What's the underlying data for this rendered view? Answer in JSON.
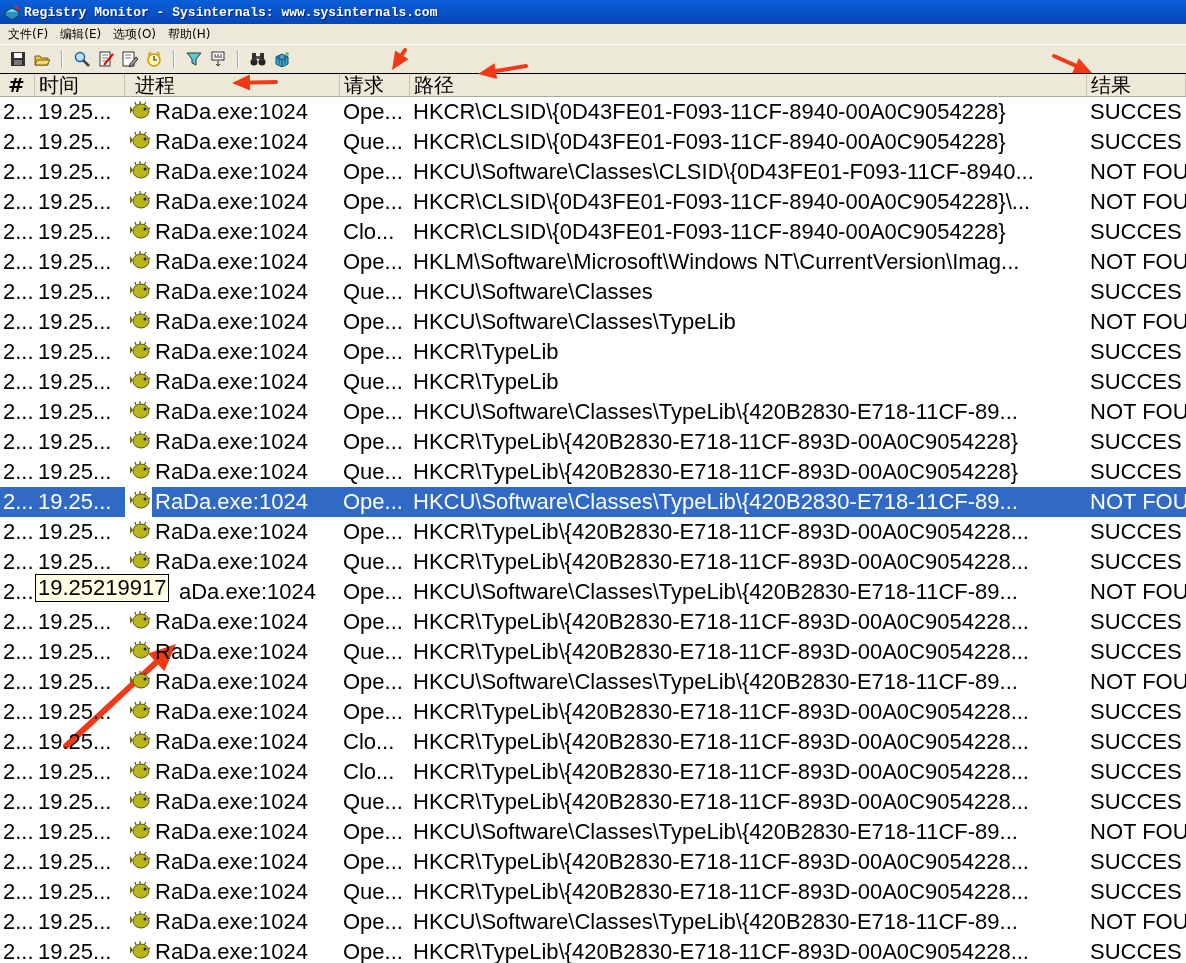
{
  "window": {
    "title": "Registry Monitor - Sysinternals: www.sysinternals.com"
  },
  "menu": [
    "文件(F)",
    "编辑(E)",
    "选项(O)",
    "帮助(H)"
  ],
  "table": {
    "columns": [
      "#",
      "时间",
      "进程",
      "请求",
      "路径",
      "结果"
    ],
    "rows": [
      {
        "num": "2...",
        "time": "19.25...",
        "process": "RaDa.exe:1024",
        "request": "Ope...",
        "path": "HKCR\\CLSID\\{0D43FE01-F093-11CF-8940-00A0C9054228}",
        "result": "SUCCES",
        "selected": false
      },
      {
        "num": "2...",
        "time": "19.25...",
        "process": "RaDa.exe:1024",
        "request": "Que...",
        "path": "HKCR\\CLSID\\{0D43FE01-F093-11CF-8940-00A0C9054228}",
        "result": "SUCCES",
        "selected": false
      },
      {
        "num": "2...",
        "time": "19.25...",
        "process": "RaDa.exe:1024",
        "request": "Ope...",
        "path": "HKCU\\Software\\Classes\\CLSID\\{0D43FE01-F093-11CF-8940...",
        "result": "NOT FOU",
        "selected": false
      },
      {
        "num": "2...",
        "time": "19.25...",
        "process": "RaDa.exe:1024",
        "request": "Ope...",
        "path": "HKCR\\CLSID\\{0D43FE01-F093-11CF-8940-00A0C9054228}\\...",
        "result": "NOT FOU",
        "selected": false
      },
      {
        "num": "2...",
        "time": "19.25...",
        "process": "RaDa.exe:1024",
        "request": "Clo...",
        "path": "HKCR\\CLSID\\{0D43FE01-F093-11CF-8940-00A0C9054228}",
        "result": "SUCCES",
        "selected": false
      },
      {
        "num": "2...",
        "time": "19.25...",
        "process": "RaDa.exe:1024",
        "request": "Ope...",
        "path": "HKLM\\Software\\Microsoft\\Windows NT\\CurrentVersion\\Imag...",
        "result": "NOT FOU",
        "selected": false
      },
      {
        "num": "2...",
        "time": "19.25...",
        "process": "RaDa.exe:1024",
        "request": "Que...",
        "path": "HKCU\\Software\\Classes",
        "result": "SUCCES",
        "selected": false
      },
      {
        "num": "2...",
        "time": "19.25...",
        "process": "RaDa.exe:1024",
        "request": "Ope...",
        "path": "HKCU\\Software\\Classes\\TypeLib",
        "result": "NOT FOU",
        "selected": false
      },
      {
        "num": "2...",
        "time": "19.25...",
        "process": "RaDa.exe:1024",
        "request": "Ope...",
        "path": "HKCR\\TypeLib",
        "result": "SUCCES",
        "selected": false
      },
      {
        "num": "2...",
        "time": "19.25...",
        "process": "RaDa.exe:1024",
        "request": "Que...",
        "path": "HKCR\\TypeLib",
        "result": "SUCCES",
        "selected": false
      },
      {
        "num": "2...",
        "time": "19.25...",
        "process": "RaDa.exe:1024",
        "request": "Ope...",
        "path": "HKCU\\Software\\Classes\\TypeLib\\{420B2830-E718-11CF-89...",
        "result": "NOT FOU",
        "selected": false
      },
      {
        "num": "2...",
        "time": "19.25...",
        "process": "RaDa.exe:1024",
        "request": "Ope...",
        "path": "HKCR\\TypeLib\\{420B2830-E718-11CF-893D-00A0C9054228}",
        "result": "SUCCES",
        "selected": false
      },
      {
        "num": "2...",
        "time": "19.25...",
        "process": "RaDa.exe:1024",
        "request": "Que...",
        "path": "HKCR\\TypeLib\\{420B2830-E718-11CF-893D-00A0C9054228}",
        "result": "SUCCES",
        "selected": false
      },
      {
        "num": "2...",
        "time": "19.25...",
        "process": "RaDa.exe:1024",
        "request": "Ope...",
        "path": "HKCU\\Software\\Classes\\TypeLib\\{420B2830-E718-11CF-89...",
        "result": "NOT FOU",
        "selected": true
      },
      {
        "num": "2...",
        "time": "19.25...",
        "process": "RaDa.exe:1024",
        "request": "Ope...",
        "path": "HKCR\\TypeLib\\{420B2830-E718-11CF-893D-00A0C9054228...",
        "result": "SUCCES",
        "selected": false
      },
      {
        "num": "2...",
        "time": "19.25...",
        "process": "RaDa.exe:1024",
        "request": "Que...",
        "path": "HKCR\\TypeLib\\{420B2830-E718-11CF-893D-00A0C9054228...",
        "result": "SUCCES",
        "selected": false
      },
      {
        "num": "2...",
        "tooltip": "19.25219917",
        "process": "aDa.exe:1024",
        "request": "Ope...",
        "path": "HKCU\\Software\\Classes\\TypeLib\\{420B2830-E718-11CF-89...",
        "result": "NOT FOU",
        "selected": false
      },
      {
        "num": "2...",
        "time": "19.25...",
        "process": "RaDa.exe:1024",
        "request": "Ope...",
        "path": "HKCR\\TypeLib\\{420B2830-E718-11CF-893D-00A0C9054228...",
        "result": "SUCCES",
        "selected": false
      },
      {
        "num": "2...",
        "time": "19.25...",
        "process": "RaDa.exe:1024",
        "request": "Que...",
        "path": "HKCR\\TypeLib\\{420B2830-E718-11CF-893D-00A0C9054228...",
        "result": "SUCCES",
        "selected": false
      },
      {
        "num": "2...",
        "time": "19.25...",
        "process": "RaDa.exe:1024",
        "request": "Ope...",
        "path": "HKCU\\Software\\Classes\\TypeLib\\{420B2830-E718-11CF-89...",
        "result": "NOT FOU",
        "selected": false
      },
      {
        "num": "2...",
        "time": "19.25...",
        "process": "RaDa.exe:1024",
        "request": "Ope...",
        "path": "HKCR\\TypeLib\\{420B2830-E718-11CF-893D-00A0C9054228...",
        "result": "SUCCES",
        "selected": false
      },
      {
        "num": "2...",
        "time": "19.25...",
        "process": "RaDa.exe:1024",
        "request": "Clo...",
        "path": "HKCR\\TypeLib\\{420B2830-E718-11CF-893D-00A0C9054228...",
        "result": "SUCCES",
        "selected": false
      },
      {
        "num": "2...",
        "time": "19.25...",
        "process": "RaDa.exe:1024",
        "request": "Clo...",
        "path": "HKCR\\TypeLib\\{420B2830-E718-11CF-893D-00A0C9054228...",
        "result": "SUCCES",
        "selected": false
      },
      {
        "num": "2...",
        "time": "19.25...",
        "process": "RaDa.exe:1024",
        "request": "Que...",
        "path": "HKCR\\TypeLib\\{420B2830-E718-11CF-893D-00A0C9054228...",
        "result": "SUCCES",
        "selected": false
      },
      {
        "num": "2...",
        "time": "19.25...",
        "process": "RaDa.exe:1024",
        "request": "Ope...",
        "path": "HKCU\\Software\\Classes\\TypeLib\\{420B2830-E718-11CF-89...",
        "result": "NOT FOU",
        "selected": false
      },
      {
        "num": "2...",
        "time": "19.25...",
        "process": "RaDa.exe:1024",
        "request": "Ope...",
        "path": "HKCR\\TypeLib\\{420B2830-E718-11CF-893D-00A0C9054228...",
        "result": "SUCCES",
        "selected": false
      },
      {
        "num": "2...",
        "time": "19.25...",
        "process": "RaDa.exe:1024",
        "request": "Que...",
        "path": "HKCR\\TypeLib\\{420B2830-E718-11CF-893D-00A0C9054228...",
        "result": "SUCCES",
        "selected": false
      },
      {
        "num": "2...",
        "time": "19.25...",
        "process": "RaDa.exe:1024",
        "request": "Ope...",
        "path": "HKCU\\Software\\Classes\\TypeLib\\{420B2830-E718-11CF-89...",
        "result": "NOT FOU",
        "selected": false
      },
      {
        "num": "2...",
        "time": "19.25...",
        "process": "RaDa.exe:1024",
        "request": "Ope...",
        "path": "HKCR\\TypeLib\\{420B2830-E718-11CF-893D-00A0C9054228...",
        "result": "SUCCES",
        "selected": false
      }
    ]
  }
}
